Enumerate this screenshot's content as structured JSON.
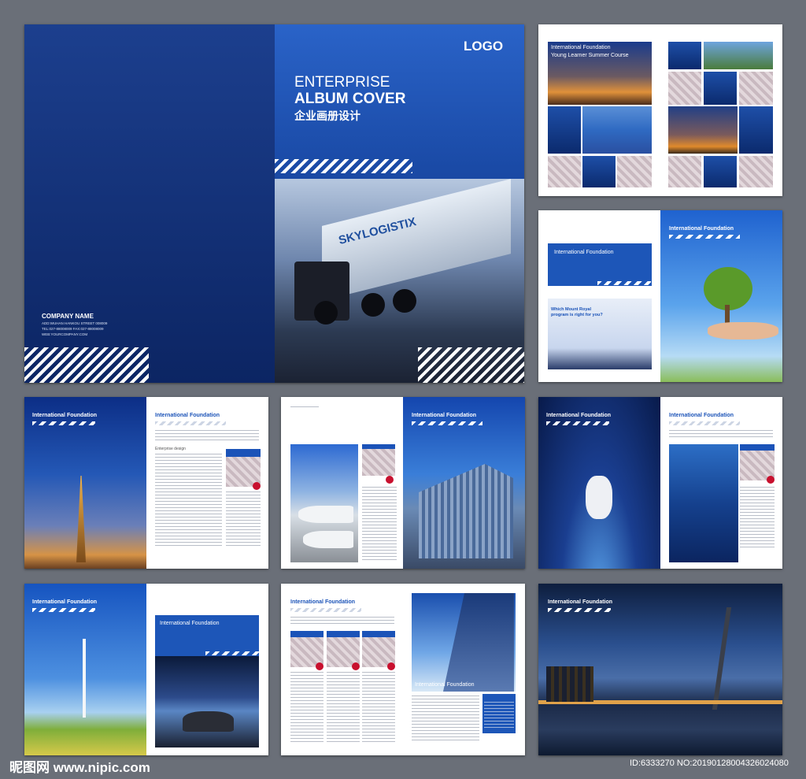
{
  "cover": {
    "logo": "LOGO",
    "title_line1": "ENTERPRISE",
    "title_line2": "ALBUM COVER",
    "title_cn": "企业画册设计",
    "truck_brand": "SKYLOGISTIX",
    "company_name": "COMPANY NAME",
    "address": "ADD:WUHAN HANKOU STREET 008009",
    "tel": "TEL:027-88008009 FAX:027-88008009",
    "web": "WEB:YOURCOMPANY.COM"
  },
  "page2": {
    "title": "International Foundation",
    "subtitle": "Young Learner Summer Course"
  },
  "page3": {
    "title": "International Foundation",
    "title_right": "International Foundation",
    "promo_line1": "Which Mount Royal",
    "promo_line2": "program is right for you?"
  },
  "page4": {
    "title_left": "International Foundation",
    "title_right": "International Foundation",
    "heading": "Enterprise design"
  },
  "page5": {
    "title": "International Foundation"
  },
  "page6": {
    "title_left": "International Foundation",
    "title_right": "International Foundation"
  },
  "page7": {
    "title_left": "International Foundation",
    "title_right": "International Foundation"
  },
  "page8": {
    "title_left": "International Foundation",
    "title_right": "International Foundation"
  },
  "page9": {
    "title": "International Foundation"
  },
  "footer": {
    "watermark": "昵图网 www.nipic.com",
    "id": "ID:6333270 NO:20190128004326024080"
  },
  "colors": {
    "accent_blue": "#1b53b8",
    "dark_blue": "#0b2a6d",
    "background": "#6a6f78"
  }
}
